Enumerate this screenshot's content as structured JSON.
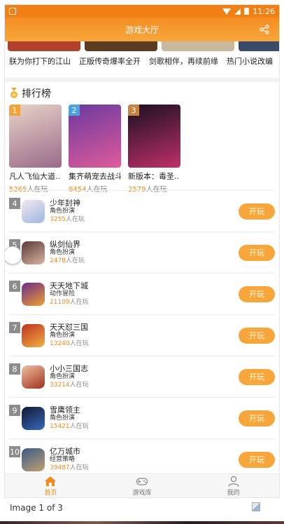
{
  "status_bar": {
    "time": "11:26"
  },
  "header": {
    "title": "游戏大厅"
  },
  "banners": [
    {
      "title": "朕为你打下的江山",
      "color": "#b0402a"
    },
    {
      "title": "正版传奇爆率全开",
      "color": "#5a3a20"
    },
    {
      "title": "剑歌相伴，再续前缘",
      "color": "#c9b8a0"
    },
    {
      "title": "热门小说改编",
      "color": "#3a4a6a"
    }
  ],
  "ranking": {
    "title": "排行榜",
    "top": [
      {
        "rank": "1",
        "name": "凡人飞仙大道..",
        "count": "5265",
        "suffix": "人在玩",
        "badge_color": "#f2a43a",
        "colors": [
          "#e8d3c6",
          "#9a6a8a"
        ]
      },
      {
        "rank": "2",
        "name": "集齐萌宠去战斗",
        "count": "8454",
        "suffix": "人在玩",
        "badge_color": "#4aa3e0",
        "colors": [
          "#6a3aa0",
          "#e05a9a"
        ]
      },
      {
        "rank": "3",
        "name": "新版本：毒圣..",
        "count": "2579",
        "suffix": "人在玩",
        "badge_color": "#c6823e",
        "colors": [
          "#1a1020",
          "#c0306a"
        ]
      }
    ],
    "list": [
      {
        "rank": "4",
        "name": "少年封神",
        "category": "角色扮演",
        "count": "3255",
        "suffix": "人在玩",
        "button": "开玩",
        "colors": [
          "#f4e6f0",
          "#9ab8e0"
        ]
      },
      {
        "rank": "5",
        "name": "纵剑仙界",
        "category": "角色扮演",
        "count": "2478",
        "suffix": "人在玩",
        "button": "开玩",
        "colors": [
          "#5a3a3a",
          "#d8b4a0"
        ]
      },
      {
        "rank": "6",
        "name": "天天地下城",
        "category": "动作冒险",
        "count": "21109",
        "suffix": "人在玩",
        "button": "开玩",
        "colors": [
          "#6a2a8a",
          "#f0a030"
        ]
      },
      {
        "rank": "7",
        "name": "天天怼三国",
        "category": "角色扮演",
        "count": "13240",
        "suffix": "人在玩",
        "button": "开玩",
        "colors": [
          "#c03020",
          "#f0b040"
        ]
      },
      {
        "rank": "8",
        "name": "小小三国志",
        "category": "角色扮演",
        "count": "33214",
        "suffix": "人在玩",
        "button": "开玩",
        "colors": [
          "#f0c0a0",
          "#a03020"
        ]
      },
      {
        "rank": "9",
        "name": "雪鹰领主",
        "category": "角色扮演",
        "count": "15421",
        "suffix": "人在玩",
        "button": "开玩",
        "colors": [
          "#101830",
          "#3a6ac0"
        ]
      },
      {
        "rank": "10",
        "name": "亿万城市",
        "category": "经营策略",
        "count": "39487",
        "suffix": "人在玩",
        "button": "开玩",
        "colors": [
          "#3a5a8a",
          "#c0a070"
        ]
      }
    ]
  },
  "tabs": [
    {
      "label": "首页",
      "icon": "home-icon",
      "active": true
    },
    {
      "label": "游戏库",
      "icon": "gamepad-icon",
      "active": false
    },
    {
      "label": "我的",
      "icon": "user-icon",
      "active": false
    }
  ],
  "caption": "Image 1 of 3",
  "colors": {
    "accent": "#f7a63b",
    "accent_dark": "#f27f14",
    "count": "#f08a1c"
  }
}
